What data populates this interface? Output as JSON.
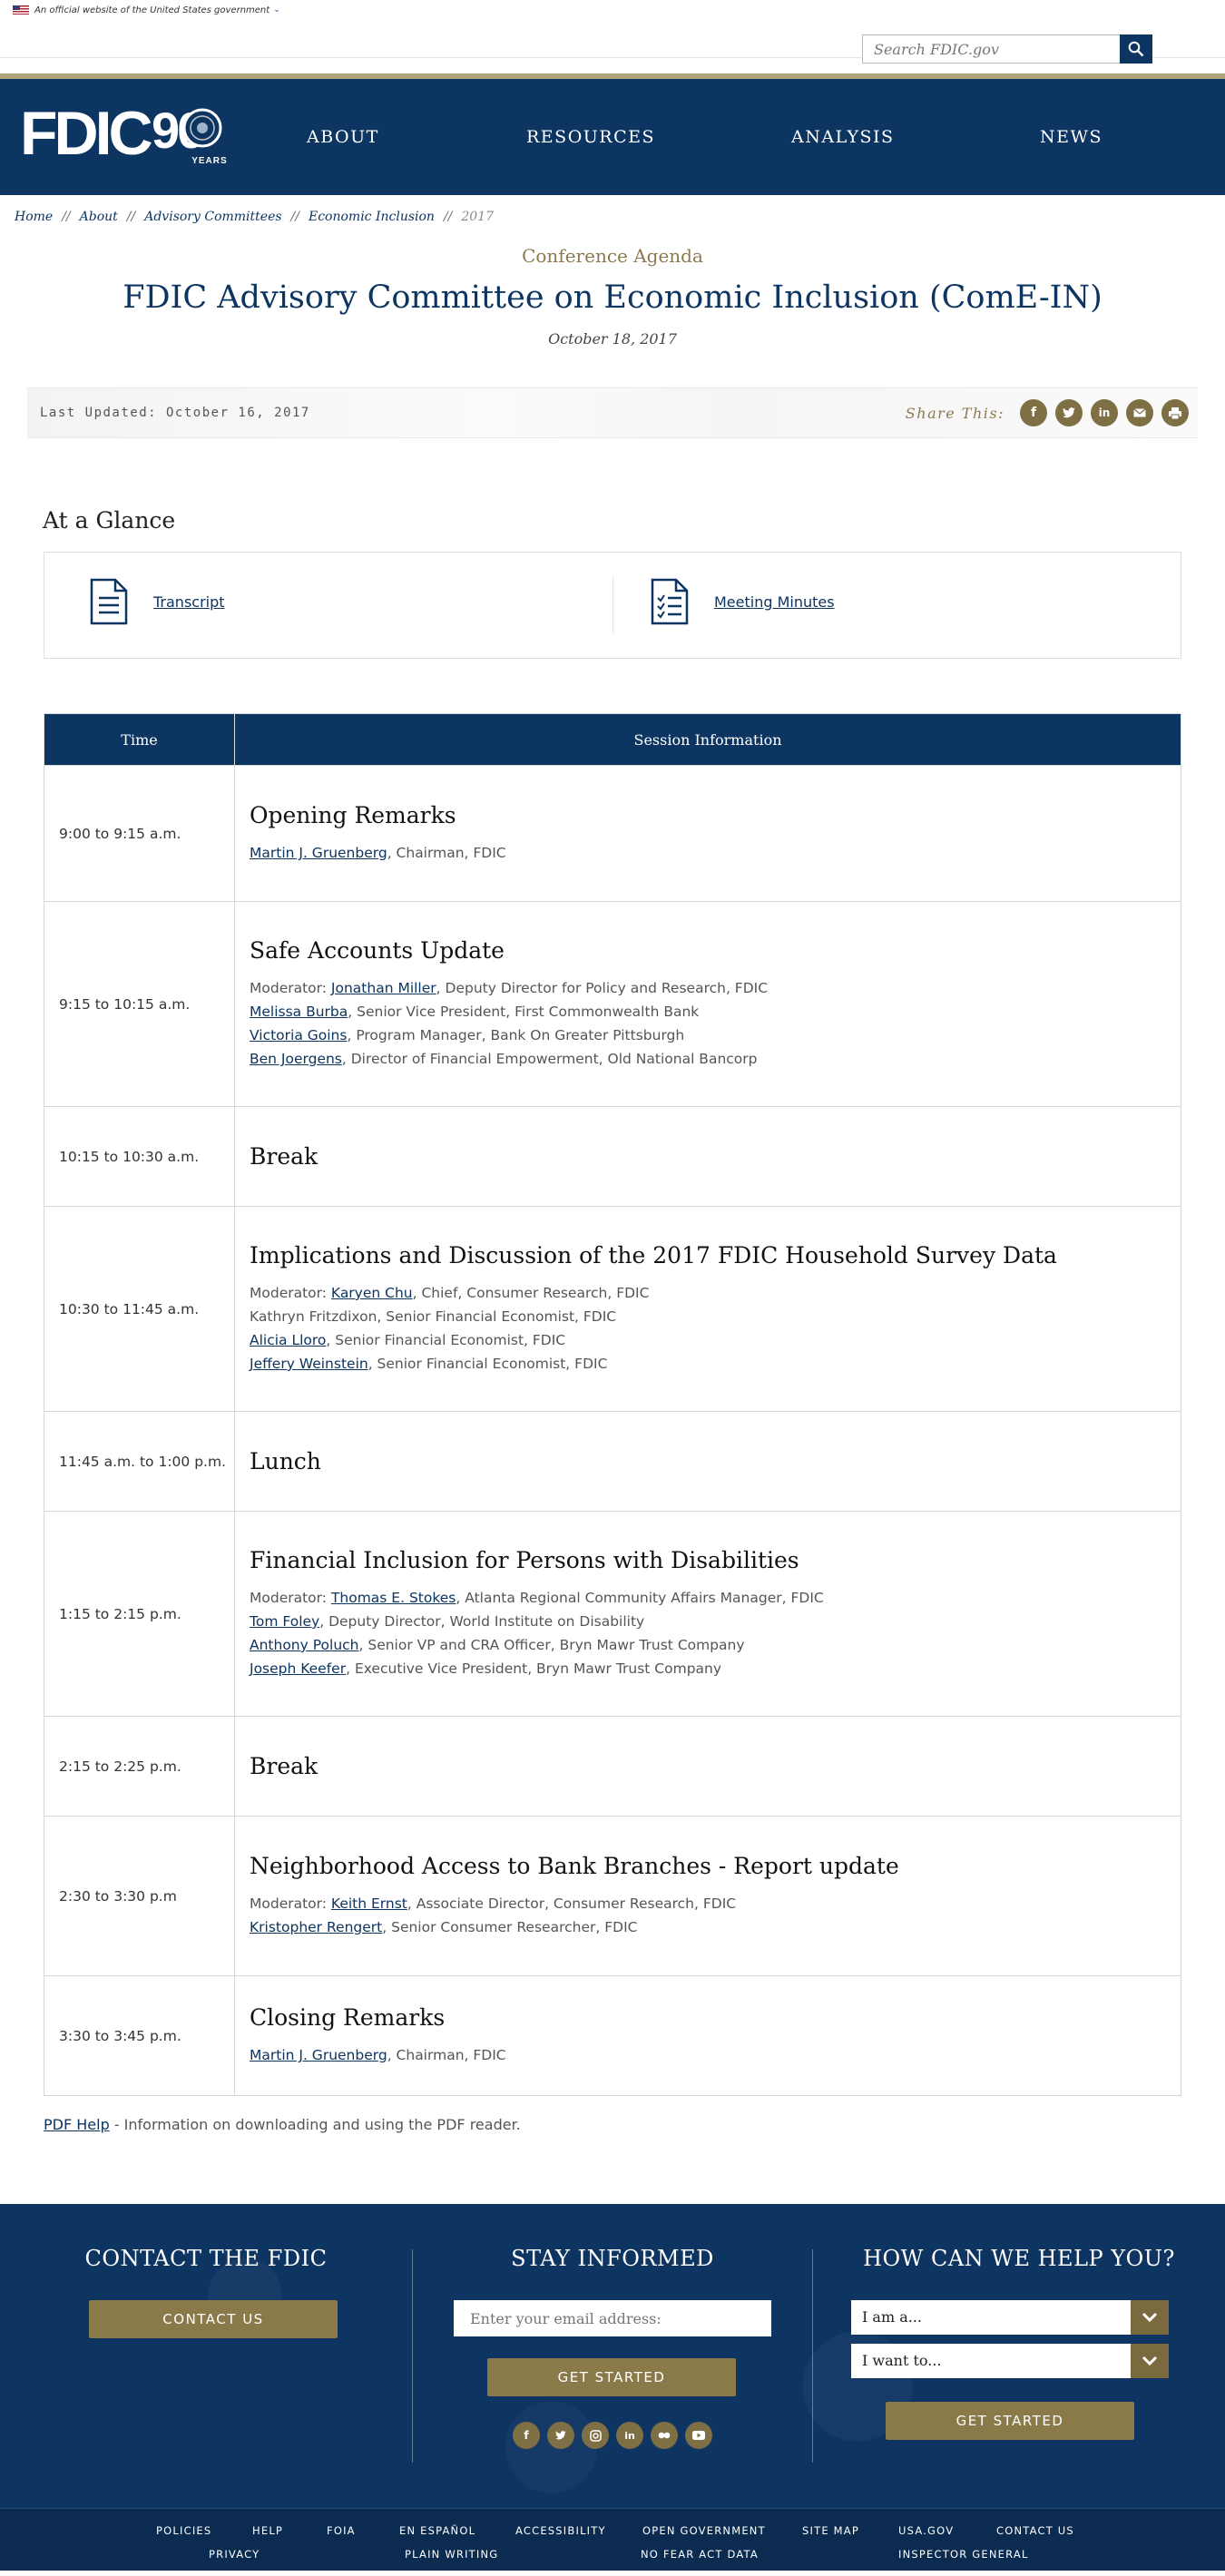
{
  "gov_banner": {
    "text": "An official website of the United States government"
  },
  "search": {
    "placeholder": "Search FDIC.gov"
  },
  "logo": {
    "text": "FDIC",
    "ninety": "90",
    "years": "YEARS"
  },
  "nav": [
    "ABOUT",
    "RESOURCES",
    "ANALYSIS",
    "NEWS"
  ],
  "breadcrumb": {
    "items": [
      "Home",
      "About",
      "Advisory Committees",
      "Economic Inclusion"
    ],
    "current": "2017",
    "separator": "//"
  },
  "page": {
    "eyebrow": "Conference Agenda",
    "title": "FDIC Advisory Committee on Economic Inclusion (ComE-IN)",
    "date": "October 18, 2017",
    "last_updated": "Last Updated: October 16, 2017",
    "share_label": "Share This:"
  },
  "share_icons": [
    "facebook-icon",
    "twitter-icon",
    "linkedin-icon",
    "email-icon",
    "print-icon"
  ],
  "glance": {
    "title": "At a Glance",
    "transcript": "Transcript",
    "minutes": "Meeting Minutes"
  },
  "agenda": {
    "headers": {
      "time": "Time",
      "session": "Session Information"
    },
    "rows": [
      {
        "time": "9:00 to 9:15 a.m.",
        "title": "Opening Remarks",
        "people": [
          {
            "prefix": "",
            "name": "Martin J. Gruenberg",
            "link": true,
            "role": ", Chairman, FDIC"
          }
        ]
      },
      {
        "time": "9:15 to 10:15 a.m.",
        "title": "Safe Accounts Update",
        "people": [
          {
            "prefix": "Moderator: ",
            "name": "Jonathan Miller",
            "link": true,
            "role": ", Deputy Director for Policy and Research, FDIC"
          },
          {
            "prefix": "",
            "name": "Melissa Burba",
            "link": true,
            "role": ", Senior Vice President, First Commonwealth Bank"
          },
          {
            "prefix": "",
            "name": "Victoria Goins",
            "link": true,
            "role": ", Program Manager, Bank On Greater Pittsburgh"
          },
          {
            "prefix": "",
            "name": "Ben Joergens",
            "link": true,
            "role": ", Director of Financial Empowerment, Old National Bancorp"
          }
        ]
      },
      {
        "time": "10:15 to 10:30 a.m.",
        "title": "Break",
        "people": []
      },
      {
        "time": "10:30 to 11:45 a.m.",
        "title": "Implications and Discussion of the 2017 FDIC Household Survey Data",
        "people": [
          {
            "prefix": "Moderator: ",
            "name": "Karyen Chu",
            "link": true,
            "role": ", Chief, Consumer Research, FDIC"
          },
          {
            "prefix": "",
            "name": "Kathryn Fritzdixon",
            "link": false,
            "role": ", Senior Financial Economist, FDIC"
          },
          {
            "prefix": "",
            "name": "Alicia Lloro",
            "link": true,
            "role": ", Senior Financial Economist, FDIC"
          },
          {
            "prefix": "",
            "name": "Jeffery Weinstein",
            "link": true,
            "role": ", Senior Financial Economist, FDIC"
          }
        ]
      },
      {
        "time": "11:45 a.m. to 1:00 p.m.",
        "title": "Lunch",
        "people": []
      },
      {
        "time": "1:15 to 2:15 p.m.",
        "title": "Financial Inclusion for Persons with Disabilities",
        "people": [
          {
            "prefix": "Moderator: ",
            "name": "Thomas E. Stokes",
            "link": true,
            "role": ", Atlanta Regional Community Affairs Manager, FDIC"
          },
          {
            "prefix": "",
            "name": "Tom Foley",
            "link": true,
            "role": ", Deputy Director, World Institute on Disability"
          },
          {
            "prefix": "",
            "name": "Anthony Poluch",
            "link": true,
            "role": ", Senior VP and CRA Officer, Bryn Mawr Trust Company"
          },
          {
            "prefix": "",
            "name": "Joseph Keefer",
            "link": true,
            "role": ", Executive Vice President, Bryn Mawr Trust Company"
          }
        ]
      },
      {
        "time": "2:15 to 2:25 p.m.",
        "title": "Break",
        "people": []
      },
      {
        "time": "2:30 to 3:30 p.m",
        "title": "Neighborhood Access to Bank Branches - Report update",
        "people": [
          {
            "prefix": "Moderator: ",
            "name": "Keith Ernst",
            "link": true,
            "role": ", Associate Director, Consumer Research, FDIC"
          },
          {
            "prefix": "",
            "name": "Kristopher Rengert",
            "link": true,
            "role": ", Senior Consumer Researcher, FDIC"
          }
        ]
      },
      {
        "time": "3:30 to 3:45 p.m.",
        "title": "Closing Remarks",
        "people": [
          {
            "prefix": "",
            "name": "Martin J. Gruenberg",
            "link": true,
            "role": ", Chairman, FDIC"
          }
        ]
      }
    ]
  },
  "pdf_help": {
    "link": "PDF Help",
    "text": " - Information on downloading and using the PDF reader."
  },
  "footer": {
    "contact_title": "CONTACT THE FDIC",
    "contact_button": "CONTACT US",
    "stay_title": "STAY INFORMED",
    "email_placeholder": "Enter your email address:",
    "stay_button": "GET STARTED",
    "help_title": "HOW CAN WE HELP YOU?",
    "select_1": "I am a...",
    "select_2": "I want to...",
    "help_button": "GET STARTED",
    "social": [
      "facebook-icon",
      "twitter-icon",
      "instagram-icon",
      "linkedin-icon",
      "flickr-icon",
      "youtube-icon"
    ]
  },
  "bottom_links": {
    "row1": [
      "POLICIES",
      "HELP",
      "FOIA",
      "EN ESPAÑOL",
      "ACCESSIBILITY",
      "OPEN GOVERNMENT",
      "SITE MAP",
      "USA.GOV",
      "CONTACT US"
    ],
    "row2": [
      "PRIVACY",
      "PLAIN WRITING",
      "NO FEAR ACT DATA",
      "INSPECTOR GENERAL"
    ]
  },
  "colors": {
    "navy": "#0d3561",
    "gold": "#8a7a4a",
    "gold_text": "#8c7a4e"
  }
}
